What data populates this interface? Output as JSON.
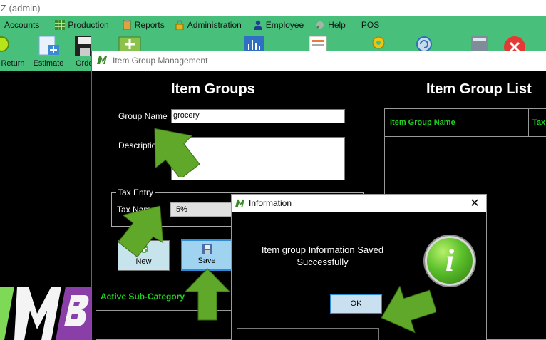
{
  "app": {
    "title": "Z (admin)"
  },
  "menu": [
    {
      "label": "Accounts",
      "icon": "accounts-icon"
    },
    {
      "label": "Production",
      "icon": "production-grid-icon"
    },
    {
      "label": "Reports",
      "icon": "reports-clipboard-icon"
    },
    {
      "label": "Administration",
      "icon": "padlock-icon"
    },
    {
      "label": "Employee",
      "icon": "person-icon"
    },
    {
      "label": "Help",
      "icon": "help-icon"
    },
    {
      "label": "POS",
      "icon": ""
    }
  ],
  "toolbar": {
    "return_label": "Return",
    "estimate_label": "Estimate",
    "order_label": "Orde"
  },
  "window": {
    "title": "Item Group Management",
    "left_heading": "Item Groups",
    "right_heading": "Item Group List",
    "group_name_label": "Group Name",
    "group_name_value": "grocery",
    "description_label": "Description",
    "description_value": "",
    "tax_entry_legend": "Tax Entry",
    "tax_name_label": "Tax Name",
    "tax_name_value": ".5%",
    "new_label": "New",
    "save_label": "Save",
    "subcategory_header": "Active Sub-Category",
    "list_columns": [
      "Item Group Name",
      "Tax"
    ]
  },
  "dialog": {
    "title": "Information",
    "message": "Item group Information Saved Successfully",
    "ok_label": "OK",
    "close_glyph": "✕"
  },
  "colors": {
    "menu_bg": "#48c07c",
    "grid_header_text": "#1ed41e",
    "arrow_green": "#5fa82a",
    "button_focus": "#2e8bd6"
  }
}
